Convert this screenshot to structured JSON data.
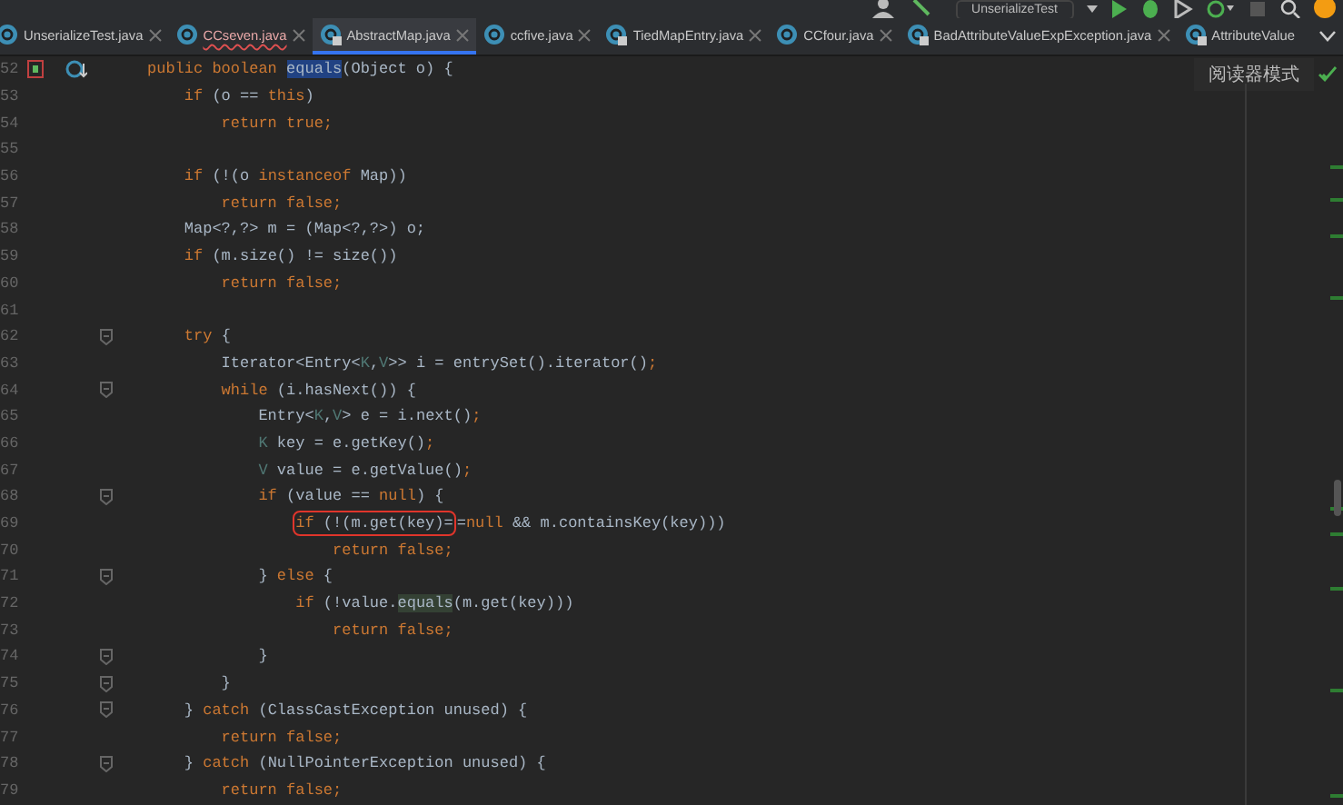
{
  "toolbar": {
    "run_configuration": "UnserializeTest"
  },
  "tabs": [
    {
      "label": "UnserializeTest.java",
      "kind": "class",
      "selected": false,
      "error": false
    },
    {
      "label": "CCseven.java",
      "kind": "class",
      "selected": false,
      "error": true
    },
    {
      "label": "AbstractMap.java",
      "kind": "library",
      "selected": true,
      "error": false
    },
    {
      "label": "ccfive.java",
      "kind": "class",
      "selected": false,
      "error": false
    },
    {
      "label": "TiedMapEntry.java",
      "kind": "library",
      "selected": false,
      "error": false
    },
    {
      "label": "CCfour.java",
      "kind": "class",
      "selected": false,
      "error": false
    },
    {
      "label": "BadAttributeValueExpException.java",
      "kind": "library",
      "selected": false,
      "error": false
    },
    {
      "label": "AttributeValue",
      "kind": "library",
      "selected": false,
      "error": false
    }
  ],
  "reader_mode": {
    "label": "阅读器模式"
  },
  "editor": {
    "lines": [
      {
        "number": "52",
        "gutter_icons": true,
        "tokens": [
          {
            "kind": "keyword",
            "text": "public boolean "
          },
          {
            "kind": "selected",
            "text": "equals"
          },
          {
            "kind": "plain",
            "text": "(Object o) {"
          }
        ]
      },
      {
        "number": "53",
        "tokens": [
          {
            "kind": "keyword",
            "text": "    if"
          },
          {
            "kind": "plain",
            "text": " (o == "
          },
          {
            "kind": "keyword",
            "text": "this"
          },
          {
            "kind": "plain",
            "text": ")"
          }
        ]
      },
      {
        "number": "54",
        "tokens": [
          {
            "kind": "keyword",
            "text": "        return true;"
          }
        ]
      },
      {
        "number": "55"
      },
      {
        "number": "56",
        "tokens": [
          {
            "kind": "keyword",
            "text": "    if"
          },
          {
            "kind": "plain",
            "text": " (!(o "
          },
          {
            "kind": "keyword",
            "text": "instanceof"
          },
          {
            "kind": "plain",
            "text": " Map))"
          }
        ]
      },
      {
        "number": "57",
        "tokens": [
          {
            "kind": "keyword",
            "text": "        return false;"
          }
        ]
      },
      {
        "number": "58",
        "tokens": [
          {
            "kind": "plain",
            "text": "    Map<?,?> m = (Map<?,?>) o;"
          }
        ]
      },
      {
        "number": "59",
        "tokens": [
          {
            "kind": "keyword",
            "text": "    if"
          },
          {
            "kind": "plain",
            "text": " (m.size() != size())"
          }
        ]
      },
      {
        "number": "60",
        "tokens": [
          {
            "kind": "keyword",
            "text": "        return false;"
          }
        ]
      },
      {
        "number": "61"
      },
      {
        "number": "62",
        "fold": true,
        "tokens": [
          {
            "kind": "keyword",
            "text": "    try"
          },
          {
            "kind": "plain",
            "text": " {"
          }
        ]
      },
      {
        "number": "63",
        "tokens": [
          {
            "kind": "plain",
            "text": "        Iterator<Entry<"
          },
          {
            "kind": "type_param",
            "text": "K"
          },
          {
            "kind": "plain",
            "text": ","
          },
          {
            "kind": "type_param",
            "text": "V"
          },
          {
            "kind": "plain",
            "text": ">> i = entrySet().iterator()"
          },
          {
            "kind": "keyword",
            "text": ";"
          }
        ]
      },
      {
        "number": "64",
        "fold": true,
        "tokens": [
          {
            "kind": "keyword",
            "text": "        while"
          },
          {
            "kind": "plain",
            "text": " (i.hasNext()) {"
          }
        ]
      },
      {
        "number": "65",
        "tokens": [
          {
            "kind": "plain",
            "text": "            Entry<"
          },
          {
            "kind": "type_param",
            "text": "K"
          },
          {
            "kind": "plain",
            "text": ","
          },
          {
            "kind": "type_param",
            "text": "V"
          },
          {
            "kind": "plain",
            "text": "> e = i.next()"
          },
          {
            "kind": "keyword",
            "text": ";"
          }
        ]
      },
      {
        "number": "66",
        "tokens": [
          {
            "kind": "type_param",
            "text": "            K"
          },
          {
            "kind": "plain",
            "text": " key = e.getKey()"
          },
          {
            "kind": "keyword",
            "text": ";"
          }
        ]
      },
      {
        "number": "67",
        "tokens": [
          {
            "kind": "type_param",
            "text": "            V"
          },
          {
            "kind": "plain",
            "text": " value = e.getValue()"
          },
          {
            "kind": "keyword",
            "text": ";"
          }
        ]
      },
      {
        "number": "68",
        "fold": true,
        "tokens": [
          {
            "kind": "keyword",
            "text": "            if"
          },
          {
            "kind": "plain",
            "text": " (value == "
          },
          {
            "kind": "keyword",
            "text": "null"
          },
          {
            "kind": "plain",
            "text": ") {"
          }
        ]
      },
      {
        "number": "69",
        "tokens": [
          {
            "kind": "keyword",
            "text": "                if",
            "boxed": true
          },
          {
            "kind": "plain",
            "text": " (!(m.get(key)=",
            "boxed": true
          },
          {
            "kind": "plain",
            "text": "="
          },
          {
            "kind": "keyword",
            "text": "null"
          },
          {
            "kind": "plain",
            "text": " && m.containsKey(key)))"
          }
        ]
      },
      {
        "number": "70",
        "tokens": [
          {
            "kind": "keyword",
            "text": "                    return false;"
          }
        ]
      },
      {
        "number": "71",
        "fold": true,
        "tokens": [
          {
            "kind": "plain",
            "text": "            } "
          },
          {
            "kind": "keyword",
            "text": "else"
          },
          {
            "kind": "plain",
            "text": " {"
          }
        ]
      },
      {
        "number": "72",
        "tokens": [
          {
            "kind": "keyword",
            "text": "                if"
          },
          {
            "kind": "plain",
            "text": " (!value."
          },
          {
            "kind": "usage",
            "text": "equals"
          },
          {
            "kind": "plain",
            "text": "(m.get(key)))"
          }
        ]
      },
      {
        "number": "73",
        "tokens": [
          {
            "kind": "keyword",
            "text": "                    return false;"
          }
        ]
      },
      {
        "number": "74",
        "fold": true,
        "tokens": [
          {
            "kind": "plain",
            "text": "            }"
          }
        ]
      },
      {
        "number": "75",
        "fold": true,
        "tokens": [
          {
            "kind": "plain",
            "text": "        }"
          }
        ]
      },
      {
        "number": "76",
        "fold": true,
        "tokens": [
          {
            "kind": "plain",
            "text": "    } "
          },
          {
            "kind": "keyword",
            "text": "catch"
          },
          {
            "kind": "plain",
            "text": " (ClassCastException unused) {"
          }
        ]
      },
      {
        "number": "77",
        "tokens": [
          {
            "kind": "keyword",
            "text": "        return false;"
          }
        ]
      },
      {
        "number": "78",
        "fold": true,
        "tokens": [
          {
            "kind": "plain",
            "text": "    } "
          },
          {
            "kind": "keyword",
            "text": "catch"
          },
          {
            "kind": "plain",
            "text": " (NullPointerException unused) {"
          }
        ]
      },
      {
        "number": "79",
        "tokens": [
          {
            "kind": "keyword",
            "text": "        return false;"
          }
        ]
      }
    ]
  }
}
